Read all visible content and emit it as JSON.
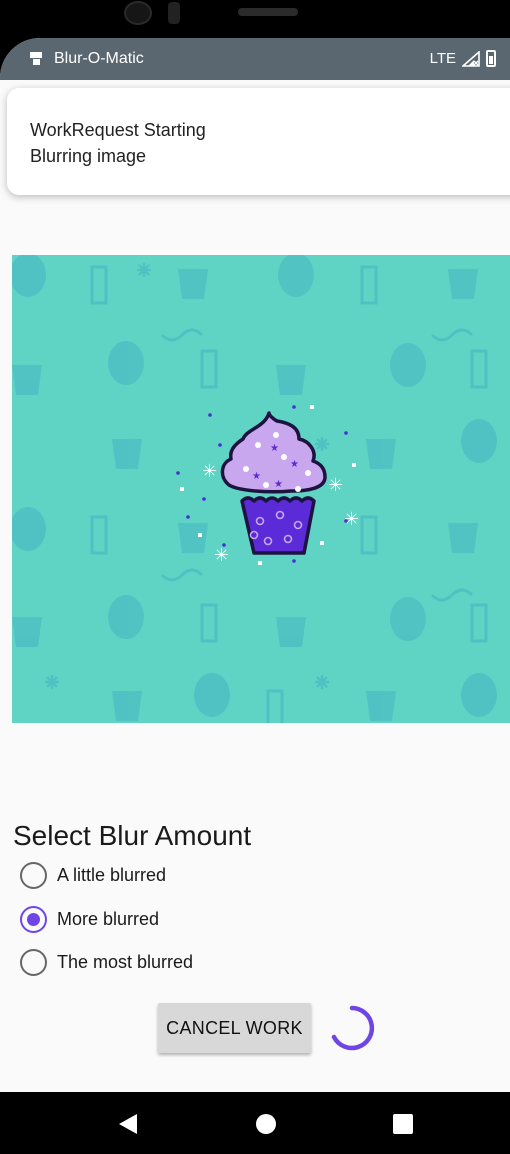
{
  "status_bar": {
    "app_name": "Blur-O-Matic",
    "network": "LTE"
  },
  "notification": {
    "title": "WorkRequest Starting",
    "text": "Blurring image"
  },
  "image": {
    "icon": "cupcake-image",
    "background_color": "#5fd4c4"
  },
  "blur_selector": {
    "title": "Select Blur Amount",
    "options": [
      {
        "label": "A little blurred",
        "selected": false
      },
      {
        "label": "More blurred",
        "selected": true
      },
      {
        "label": "The most blurred",
        "selected": false
      }
    ]
  },
  "actions": {
    "cancel_label": "CANCEL WORK"
  },
  "colors": {
    "accent": "#7045e5",
    "status_bar": "#5a6770"
  },
  "nav_bar": {
    "icons": [
      "back-icon",
      "home-icon",
      "recents-icon"
    ]
  }
}
